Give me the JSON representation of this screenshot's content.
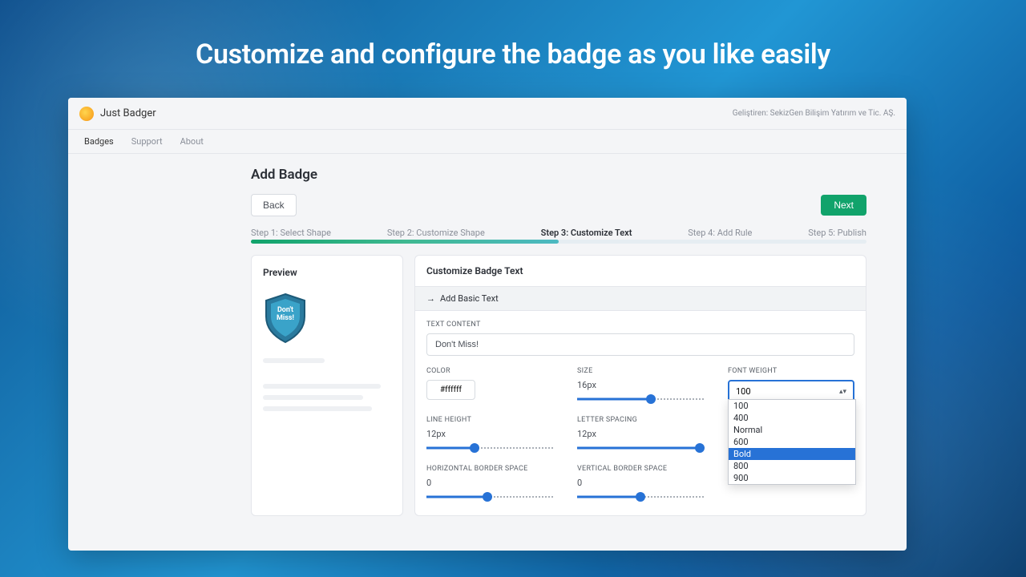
{
  "headline": "Customize and configure the badge as you like easily",
  "app": {
    "title": "Just Badger",
    "right_text": "Geliştiren: SekizGen Bilişim Yatırım ve Tic. AŞ."
  },
  "nav": {
    "items": [
      "Badges",
      "Support",
      "About"
    ]
  },
  "page": {
    "title": "Add Badge",
    "back_label": "Back",
    "next_label": "Next"
  },
  "steps": [
    "Step 1: Select Shape",
    "Step 2: Customize Shape",
    "Step 3: Customize Text",
    "Step 4: Add Rule",
    "Step 5: Publish"
  ],
  "preview": {
    "title": "Preview",
    "badge_text_line1": "Don't",
    "badge_text_line2": "Miss!"
  },
  "form": {
    "title": "Customize Badge Text",
    "add_basic_text": "Add Basic Text",
    "text_content_label": "TEXT CONTENT",
    "text_content_value": "Don't Miss!",
    "color_label": "COLOR",
    "color_value": "#ffffff",
    "size_label": "SIZE",
    "size_value": "16px",
    "font_weight_label": "FONT WEIGHT",
    "font_weight_value": "100",
    "font_weight_options": [
      "100",
      "400",
      "Normal",
      "600",
      "Bold",
      "800",
      "900"
    ],
    "line_height_label": "LINE HEIGHT",
    "line_height_value": "12px",
    "letter_spacing_label": "LETTER SPACING",
    "letter_spacing_value": "12px",
    "hbs_label": "HORIZONTAL BORDER SPACE",
    "hbs_value": "0",
    "vbs_label": "VERTICAL BORDER SPACE",
    "vbs_value": "0"
  }
}
